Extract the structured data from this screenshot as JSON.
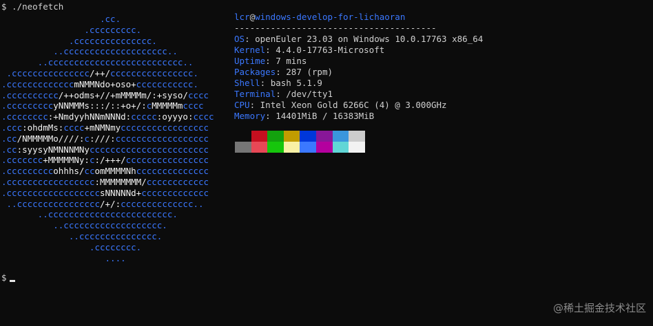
{
  "window": {
    "background": "#0c0c0c"
  },
  "command": {
    "text": "$ ./neofetch"
  },
  "logo": {
    "color": "#3b78ff",
    "lines": [
      "                   .cc.",
      "                .ccccccccc.",
      "             .ccccccccccccccc.",
      "          ..cccccccccccccccccccc..",
      "       ..cccccccccccccccccccccccccc..",
      " .ccccccccccccccc/++/cccccccccccccccc.",
      ".cccccccccccccmNMMNdo+oso+ccccccccccc.",
      ".cccccccccc/++odms+//+mMMMMm/:+syso/cccc",
      ".cccccccccyNNMMMs:::/::+o+/:cMMMMMmcccc",
      ".cccccccc:+NmdyyhNNmNNNd:ccccc:oyyyo:cccc",
      ".ccc:ohdmMs:cccc+mNMNmyccccccccccccccccc",
      ".cc/NMMMMMo////:c:///:cccccccccccccccccc",
      ".cc:syysyNMNNNMNyccccccccccccccccccccccc",
      ".ccccccc+MMMMMNy:c:/+++/cccccccccccccccc",
      ".cccccccccohhhs/ccomMMMMNhcccccccccccccc",
      ".ccccccccccccccccc:MMMMMMMM/cccccccccccc",
      ".ccccccccccccccccccsNNNNNd+ccccccccccccc",
      " ..cccccccccccccccc/+/:cccccccccccccc..",
      "       ..cccccccccccccccccccccccc.",
      "          ..ccccccccccccccccccc.",
      "             ..ccccccccccccccc.",
      "                 .cccccccc.",
      "                    ...."
    ]
  },
  "info": {
    "user": "lcr",
    "at": "@",
    "host": "windows-develop-for-lichaoran",
    "separator": "---------------------------------------",
    "rows": [
      {
        "key": "OS",
        "value": "openEuler 23.03 on Windows 10.0.17763 x86_64"
      },
      {
        "key": "Kernel",
        "value": "4.4.0-17763-Microsoft"
      },
      {
        "key": "Uptime",
        "value": "7 mins"
      },
      {
        "key": "Packages",
        "value": "287 (rpm)"
      },
      {
        "key": "Shell",
        "value": "bash 5.1.9"
      },
      {
        "key": "Terminal",
        "value": "/dev/tty1"
      },
      {
        "key": "CPU",
        "value": "Intel Xeon Gold 6266C (4) @ 3.000GHz"
      },
      {
        "key": "Memory",
        "value": "14401MiB / 16383MiB"
      }
    ]
  },
  "palette": {
    "normal": [
      "#0c0c0c",
      "#c50f1f",
      "#13a10e",
      "#c19c00",
      "#0037da",
      "#881798",
      "#3a96dd",
      "#cccccc"
    ],
    "bright": [
      "#767676",
      "#e74856",
      "#16c60c",
      "#f9f1a5",
      "#3b78ff",
      "#b4009e",
      "#61d6d6",
      "#f2f2f2"
    ]
  },
  "prompt": {
    "text": "$"
  },
  "watermark": {
    "text": "@稀土掘金技术社区"
  }
}
